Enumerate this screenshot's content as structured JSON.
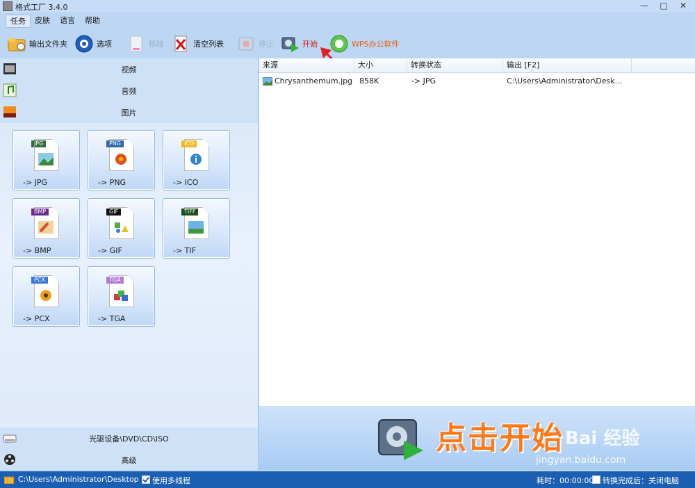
{
  "window": {
    "title": "格式工厂 3.4.0",
    "minimize": "—",
    "maximize": "□",
    "close": "✕"
  },
  "menu": [
    "任务",
    "皮肤",
    "语言",
    "帮助"
  ],
  "toolbar": {
    "output_folder": "输出文件夹",
    "options": "选项",
    "remove": "移除",
    "clear_list": "清空列表",
    "stop": "停止",
    "start": "开始",
    "wps": "WPS办公软件"
  },
  "categories": {
    "video": "视频",
    "audio": "音频",
    "picture": "图片",
    "optical": "光驱设备\\DVD\\CD\\ISO",
    "advanced": "高级"
  },
  "tiles": [
    {
      "badge": "JPG",
      "label": "-> JPG",
      "color": "#2f6e3a"
    },
    {
      "badge": "PNG",
      "label": "-> PNG",
      "color": "#2b6aa8"
    },
    {
      "badge": "ICO",
      "label": "-> ICO",
      "color": "#f2b825"
    },
    {
      "badge": "BMP",
      "label": "-> BMP",
      "color": "#6b2a8c"
    },
    {
      "badge": "GIF",
      "label": "-> GIF",
      "color": "#111111"
    },
    {
      "badge": "TIFF",
      "label": "-> TIF",
      "color": "#1d4f1d"
    },
    {
      "badge": "PCX",
      "label": "-> PCX",
      "color": "#3a7ad8"
    },
    {
      "badge": "TGA",
      "label": "-> TGA",
      "color": "#b07cd4"
    }
  ],
  "table": {
    "headers": [
      "来源",
      "大小",
      "转换状态",
      "输出 [F2]"
    ],
    "rows": [
      {
        "source": "Chrysanthemum.jpg",
        "size": "858K",
        "status": "-> JPG",
        "output": "C:\\Users\\Administrator\\Desk..."
      }
    ]
  },
  "banner": {
    "text": "点击开始",
    "watermark": "Bai 经验",
    "url": "jingyan.baidu.com"
  },
  "status": {
    "path": "C:\\Users\\Administrator\\Desktop",
    "multithread": "使用多线程",
    "elapsed": "耗时：00:00:00",
    "after_done": "转换完成后：关闭电脑"
  },
  "colors": {
    "accent": "#1b5fb3",
    "start_text": "#d21f1f",
    "wps_text": "#e85d0c",
    "banner_text": "#ff7a1a"
  }
}
